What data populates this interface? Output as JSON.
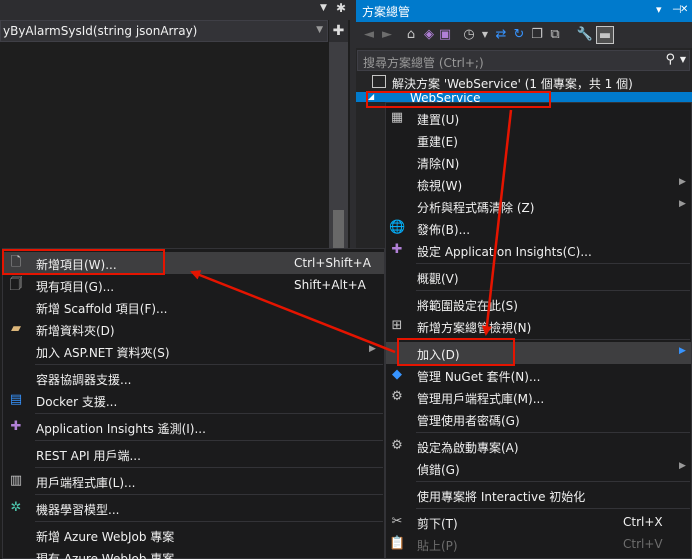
{
  "editor": {
    "nav_text": "yByAlarmSysId(string jsonArray)",
    "split_glyph": "✚"
  },
  "solution_explorer": {
    "title": "方案總管",
    "title_icons": [
      "▾",
      "⊣",
      "✕"
    ],
    "search_placeholder": "搜尋方案總管 (Ctrl+;)",
    "solution_label": "解決方案 'WebService' (1 個專案，共 1 個)",
    "project_label": "WebService"
  },
  "context_menu": {
    "items": [
      {
        "label": "建置(U)",
        "icon": "build-icon"
      },
      {
        "label": "重建(E)"
      },
      {
        "label": "清除(N)"
      },
      {
        "label": "檢視(W)",
        "submenu": true
      },
      {
        "label": "分析與程式碼清除 (Z)",
        "submenu": true
      },
      {
        "label": "發佈(B)...",
        "icon": "globe-icon"
      },
      {
        "label": "設定 Application Insights(C)...",
        "icon": "insights-icon"
      },
      {
        "label": "概觀(V)"
      },
      {
        "label": "將範圍設定在此(S)"
      },
      {
        "label": "新增方案總管檢視(N)",
        "icon": "new-view-icon"
      },
      {
        "label": "加入(D)",
        "submenu": true
      },
      {
        "label": "管理 NuGet 套件(N)...",
        "icon": "nuget-icon"
      },
      {
        "label": "管理用戶端程式庫(M)...",
        "icon": "library-icon"
      },
      {
        "label": "管理使用者密碼(G)"
      },
      {
        "label": "設定為啟動專案(A)",
        "icon": "gear-icon"
      },
      {
        "label": "偵錯(G)",
        "submenu": true
      },
      {
        "label": "使用專案將 Interactive 初始化"
      },
      {
        "label": "剪下(T)",
        "shortcut": "Ctrl+X",
        "icon": "scissors-icon"
      },
      {
        "label": "貼上(P)",
        "shortcut": "Ctrl+V",
        "icon": "paste-icon"
      }
    ]
  },
  "add_submenu": {
    "items": [
      {
        "label": "新增項目(W)...",
        "shortcut": "Ctrl+Shift+A",
        "icon": "new-item-icon"
      },
      {
        "label": "現有項目(G)...",
        "shortcut": "Shift+Alt+A",
        "icon": "existing-item-icon"
      },
      {
        "label": "新增 Scaffold 項目(F)..."
      },
      {
        "label": "新增資料夾(D)",
        "icon": "folder-icon"
      },
      {
        "label": "加入 ASP.NET 資料夾(S)",
        "submenu": true
      },
      {
        "label": "容器協調器支援..."
      },
      {
        "label": "Docker 支援...",
        "icon": "docker-icon"
      },
      {
        "label": "Application Insights 遙測(I)...",
        "icon": "insights-icon"
      },
      {
        "label": "REST API 用戶端..."
      },
      {
        "label": "用戶端程式庫(L)...",
        "icon": "library-icon"
      },
      {
        "label": "機器學習模型...",
        "icon": "ml-icon"
      },
      {
        "label": "新增 Azure WebJob 專案"
      },
      {
        "label": "現有 Azure WebJob 專案"
      }
    ]
  },
  "colors": {
    "accent": "#007acc",
    "annotation": "#e51400",
    "menu_bg": "#1b1b1c",
    "highlight": "#3e3e40"
  }
}
